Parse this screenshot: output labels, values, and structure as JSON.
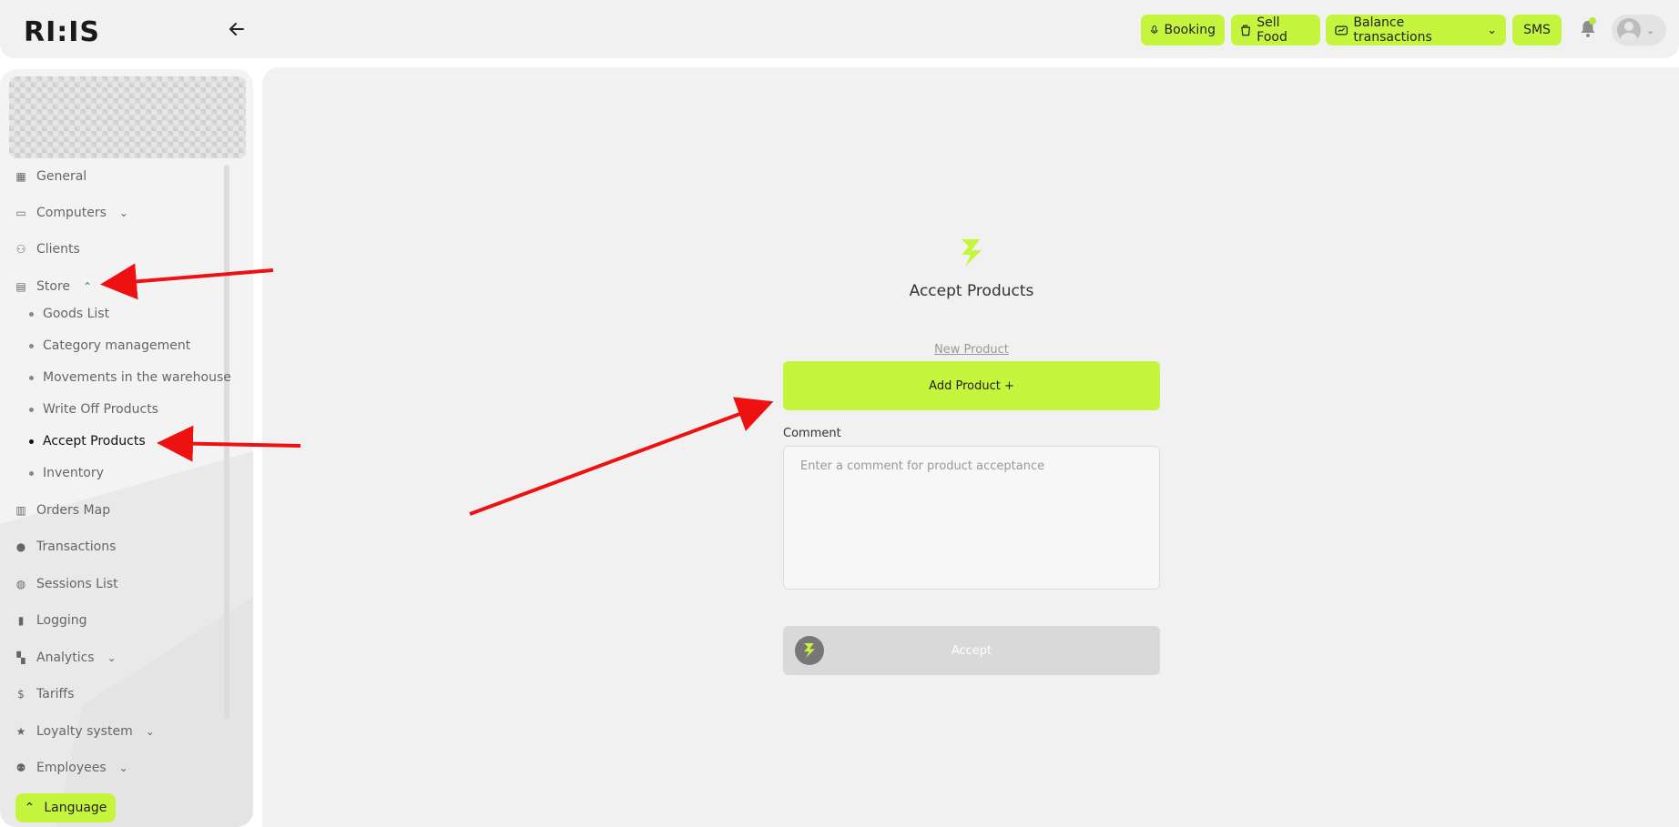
{
  "header": {
    "logo_text": "RI:IS",
    "back_icon": "arrow-left-icon",
    "buttons": [
      {
        "label": "Booking",
        "icon": "microphone-icon"
      },
      {
        "label": "Sell Food",
        "icon": "cup-icon"
      },
      {
        "label": "Balance transactions",
        "icon": "wallet-icon"
      },
      {
        "label": "SMS"
      }
    ],
    "accent_color": "#c6f53e"
  },
  "sidebar": {
    "items": [
      {
        "label": "General",
        "icon": "grid-icon"
      },
      {
        "label": "Computers",
        "icon": "laptop-icon"
      },
      {
        "label": "Clients",
        "icon": "users-icon"
      },
      {
        "label": "Store",
        "icon": "store-icon"
      },
      {
        "label": "Orders Map",
        "icon": "map-icon"
      },
      {
        "label": "Transactions",
        "icon": "coin-icon"
      },
      {
        "label": "Sessions List",
        "icon": "mouse-icon"
      },
      {
        "label": "Logging",
        "icon": "document-icon"
      },
      {
        "label": "Analytics",
        "icon": "dashboard-icon"
      },
      {
        "label": "Tariffs",
        "icon": "dollar-icon"
      },
      {
        "label": "Loyalty system",
        "icon": "star-icon"
      },
      {
        "label": "Employees",
        "icon": "person-icon"
      }
    ],
    "store_subitems": [
      {
        "label": "Goods List"
      },
      {
        "label": "Category management"
      },
      {
        "label": "Movements in the warehouse"
      },
      {
        "label": "Write Off Products"
      },
      {
        "label": "Accept Products"
      },
      {
        "label": "Inventory"
      }
    ],
    "language_label": "Language"
  },
  "main": {
    "title": "Accept Products",
    "new_product_link": "New Product",
    "add_product_button": "Add Product +",
    "comment_label": "Comment",
    "comment_placeholder": "Enter a comment for product acceptance",
    "accept_button": "Accept"
  }
}
